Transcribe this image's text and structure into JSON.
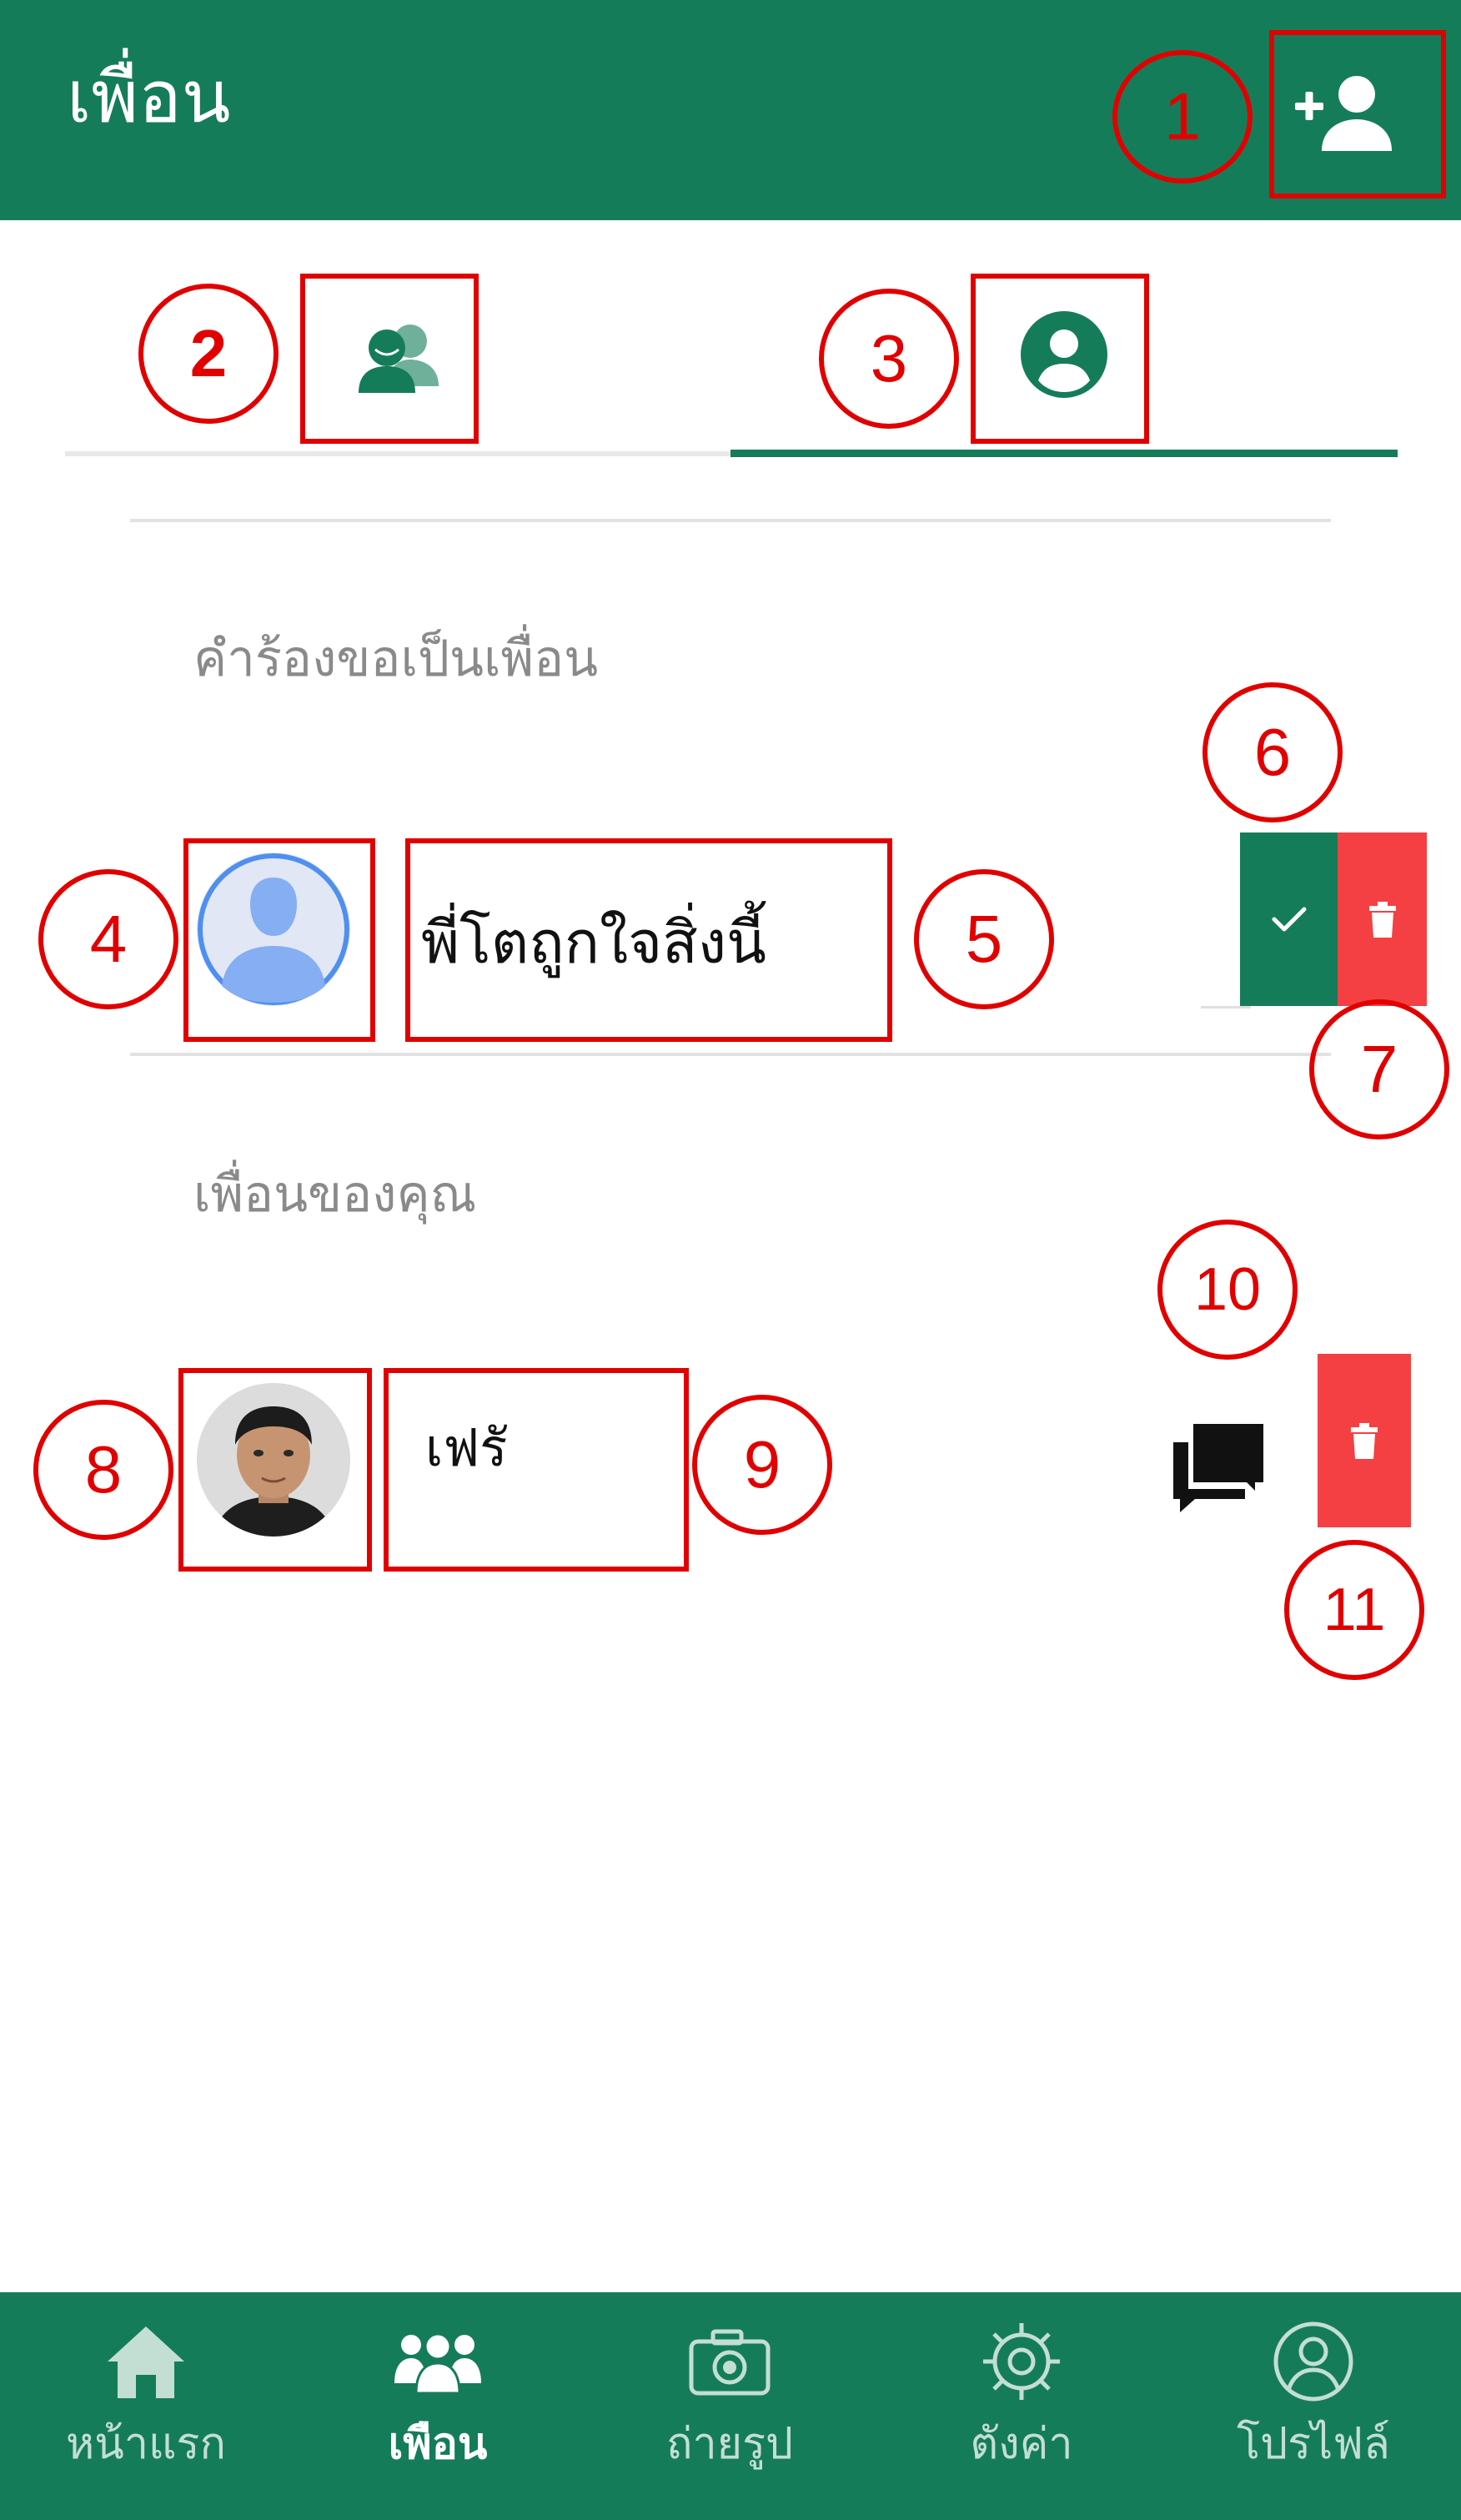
{
  "header": {
    "title": "เพื่อน"
  },
  "sections": {
    "requests_title": "คำร้องขอเป็นเพื่อน",
    "friends_title": "เพื่อนของคุณ"
  },
  "friend_request": {
    "name": "พี่โตถูกใจสิ่งนี้"
  },
  "friend": {
    "name": "เฟรั"
  },
  "bottom_nav": [
    {
      "label": "หน้าแรก",
      "icon": "home-icon",
      "active": false
    },
    {
      "label": "เพือน",
      "icon": "friends-icon",
      "active": true
    },
    {
      "label": "ถ่ายรูป",
      "icon": "camera-icon",
      "active": false
    },
    {
      "label": "ตังค่า",
      "icon": "settings-icon",
      "active": false
    },
    {
      "label": "โปรไฟล์",
      "icon": "profile-icon",
      "active": false
    }
  ],
  "annotations": [
    "1",
    "2",
    "3",
    "4",
    "5",
    "6",
    "7",
    "8",
    "9",
    "10",
    "11"
  ],
  "colors": {
    "primary": "#157c59",
    "danger": "#f44043",
    "annotation": "#e10000",
    "muted": "#8a8a8a"
  }
}
